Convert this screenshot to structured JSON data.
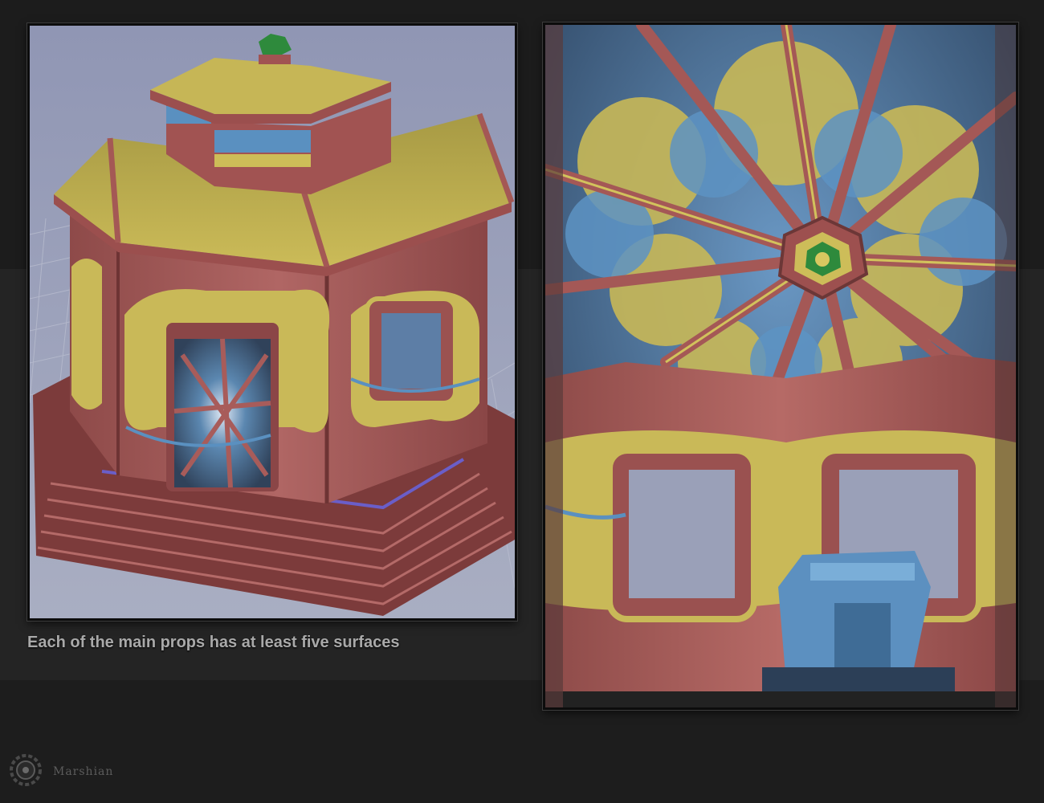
{
  "caption": "Each of the main props has at least five surfaces",
  "brand": {
    "name": "Marshian"
  },
  "images": {
    "left": "pavilion-exterior-render",
    "right": "pavilion-ceiling-interior-render"
  },
  "colors": {
    "red_surface": "#a85a58",
    "yellow_surface": "#cfc05a",
    "blue_surface": "#5a90c0",
    "green_finial": "#2e8a3c",
    "viewport_bg": "#9aa0b8"
  }
}
